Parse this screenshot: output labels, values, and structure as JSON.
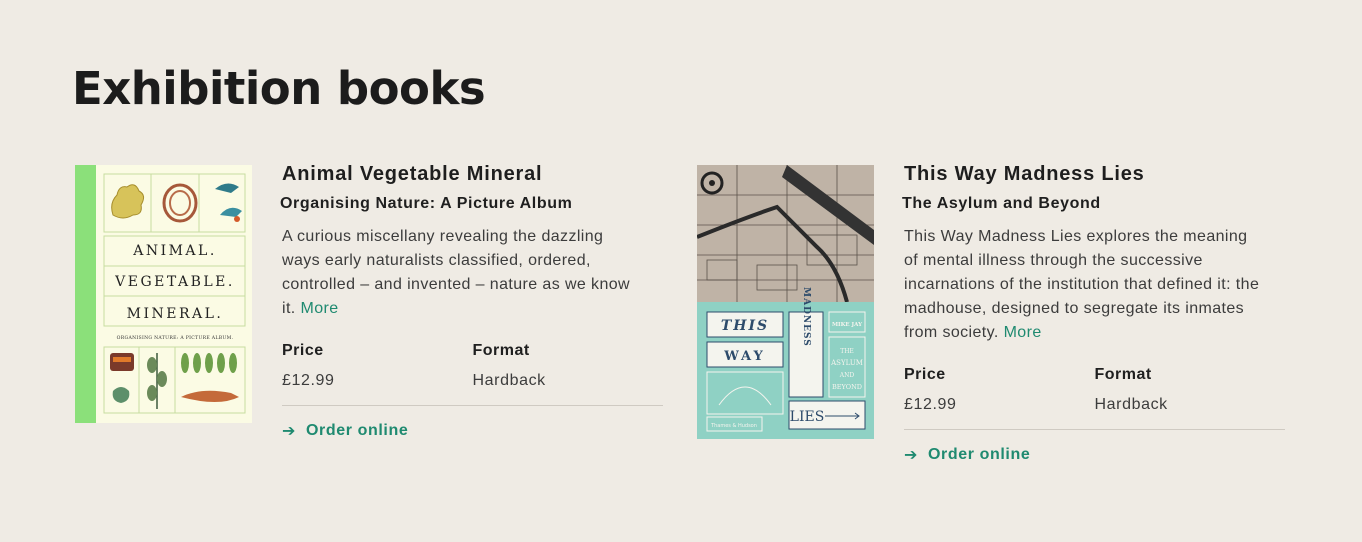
{
  "page": {
    "title": "Exhibition books"
  },
  "books": [
    {
      "title": "Animal Vegetable Mineral",
      "subtitle": "Organising Nature: A Picture Album",
      "description": "A curious miscellany revealing the dazzling ways early naturalists classified, ordered, controlled – and invented – nature as we know it.",
      "more_label": "More",
      "price_label": "Price",
      "price": "£12.99",
      "format_label": "Format",
      "format": "Hardback",
      "order_label": "Order online",
      "cover": {
        "line1": "ANIMAL.",
        "line2": "VEGETABLE.",
        "line3": "MINERAL.",
        "tagline": "ORGANISING NATURE: A PICTURE ALBUM."
      }
    },
    {
      "title": "This Way Madness Lies",
      "subtitle": "The Asylum and Beyond",
      "description": "This Way Madness Lies explores the meaning of mental illness through the successive incarnations of the institution that defined it: the madhouse, designed to segregate its inmates from society.",
      "more_label": "More",
      "price_label": "Price",
      "price": "£12.99",
      "format_label": "Format",
      "format": "Hardback",
      "order_label": "Order online",
      "cover": {
        "word1": "THIS",
        "word2": "WAY",
        "word3": "MADNESS",
        "word4": "LIES",
        "author": "MIKE JAY",
        "sub1": "THE",
        "sub2": "ASYLUM",
        "sub3": "AND",
        "sub4": "BEYOND",
        "publisher": "Thames & Hudson"
      }
    }
  ],
  "colors": {
    "accent": "#1f8a70",
    "background": "#efebe4"
  }
}
